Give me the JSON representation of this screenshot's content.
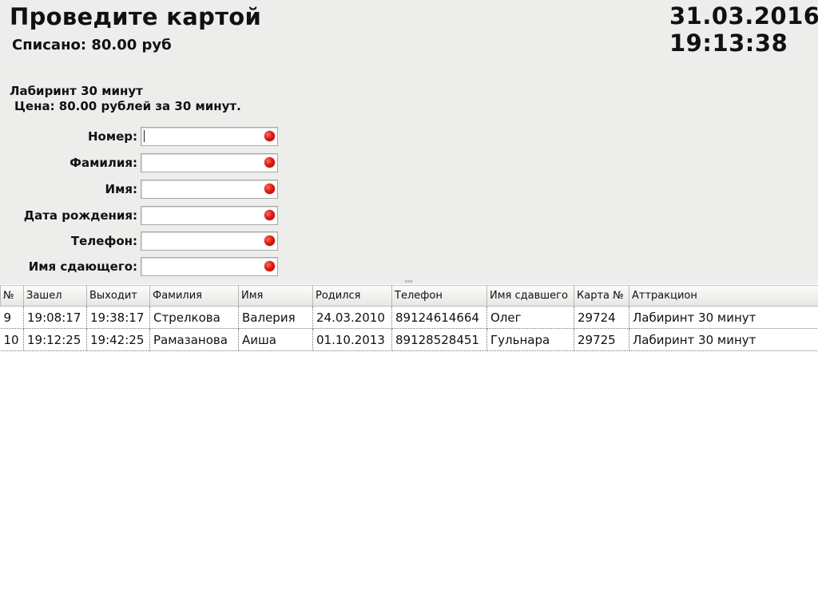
{
  "header": {
    "title": "Проведите картой",
    "charged": "Списано: 80.00 руб",
    "date": "31.03.2016",
    "time": "19:13:38"
  },
  "attraction": {
    "name": "Лабиринт 30 минут",
    "price": "Цена: 80.00 рублей за 30 минут."
  },
  "form": {
    "fields": [
      {
        "label": "Номер:",
        "value": "",
        "status": "red"
      },
      {
        "label": "Фамилия:",
        "value": "",
        "status": "red"
      },
      {
        "label": "Имя:",
        "value": "",
        "status": "red"
      },
      {
        "label": "Дата рождения:",
        "value": "",
        "status": "red"
      },
      {
        "label": "Телефон:",
        "value": "",
        "status": "red"
      },
      {
        "label": "Имя сдающего:",
        "value": "",
        "status": "red"
      }
    ]
  },
  "table": {
    "columns": [
      "№",
      "Зашел",
      "Выходит",
      "Фамилия",
      "Имя",
      "Родился",
      "Телефон",
      "Имя сдавшего",
      "Карта №",
      "Аттракцион"
    ],
    "rows": [
      [
        "9",
        "19:08:17",
        "19:38:17",
        "Стрелкова",
        "Валерия",
        "24.03.2010",
        "89124614664",
        "Олег",
        "29724",
        "Лабиринт 30 минут"
      ],
      [
        "10",
        "19:12:25",
        "19:42:25",
        "Рамазанова",
        "Аиша",
        "01.10.2013",
        "89128528451",
        "Гульнара",
        "29725",
        "Лабиринт 30 минут"
      ]
    ]
  },
  "colors": {
    "panel_bg": "#ededeb",
    "status_red": "#e21b12"
  }
}
